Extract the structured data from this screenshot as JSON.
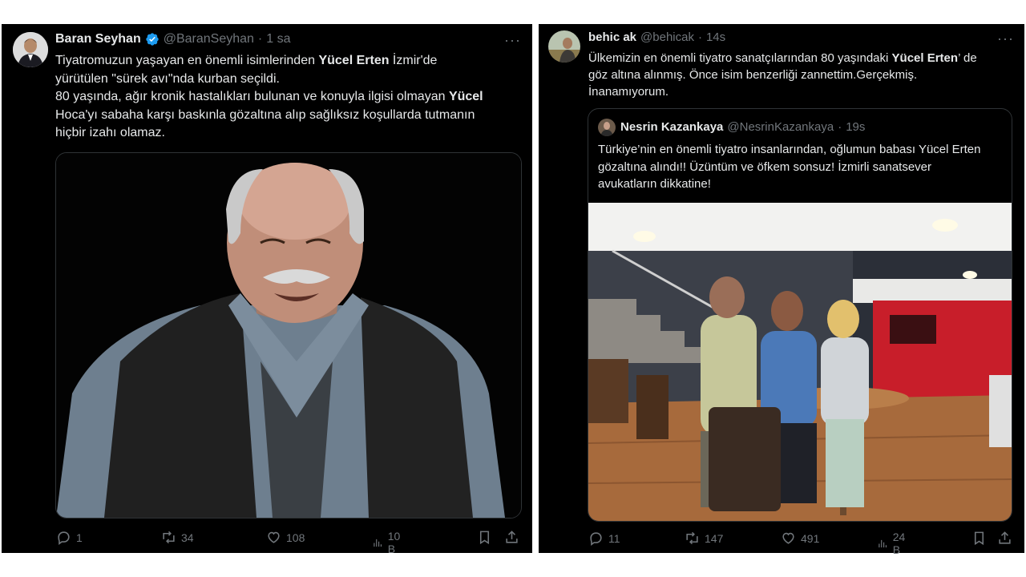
{
  "tweet_left": {
    "author_name": "Baran Seyhan",
    "handle": "@BaranSeyhan",
    "time": "1 sa",
    "more": "···",
    "text": {
      "l1a": "Tiyatromuzun yaşayan en önemli isimlerinden ",
      "l1b": "Yücel Erten",
      "l1c": " İzmir'de",
      "l2": "yürütülen \"sürek avı\"nda kurban seçildi.",
      "l3a": "80 yaşında, ağır kronik hastalıkları bulunan ve konuyla ilgisi olmayan ",
      "l3b": "Yücel",
      "l4": "Hoca'yı sabaha karşı baskınla gözaltına alıp sağlıksız koşullarda tutmanın",
      "l5": "hiçbir izahı olamaz."
    },
    "stats": {
      "replies": "1",
      "reposts": "34",
      "likes": "108",
      "views": "10 B"
    }
  },
  "tweet_right": {
    "author_name": "behic ak",
    "handle": "@behicak",
    "time": "14s",
    "more": "···",
    "text": {
      "l1a": "Ülkemizin en önemli tiyatro sanatçılarından 80 yaşındaki ",
      "l1b": "Yücel Erten",
      "l1c": "’ de",
      "l2": "göz altına alınmış. Önce isim benzerliği zannettim.Gerçekmiş.",
      "l3": "İnanamıyorum."
    },
    "quote": {
      "author_name": "Nesrin Kazankaya",
      "handle": "@NesrinKazankaya",
      "time": "19s",
      "l1": "Türkiye’nin en önemli tiyatro insanlarından, oğlumun babası Yücel Erten",
      "l2": "gözaltına alındı!! Üzüntüm ve öfkem sonsuz! İzmirli sanatsever",
      "l3": "avukatların dikkatine!"
    },
    "stats": {
      "replies": "11",
      "reposts": "147",
      "likes": "491",
      "views": "24 B"
    }
  },
  "colors": {
    "verified": "#1d9bf0",
    "muted": "#71767b",
    "text": "#e7e9ea",
    "bg": "#000000",
    "border": "#2f3336"
  }
}
